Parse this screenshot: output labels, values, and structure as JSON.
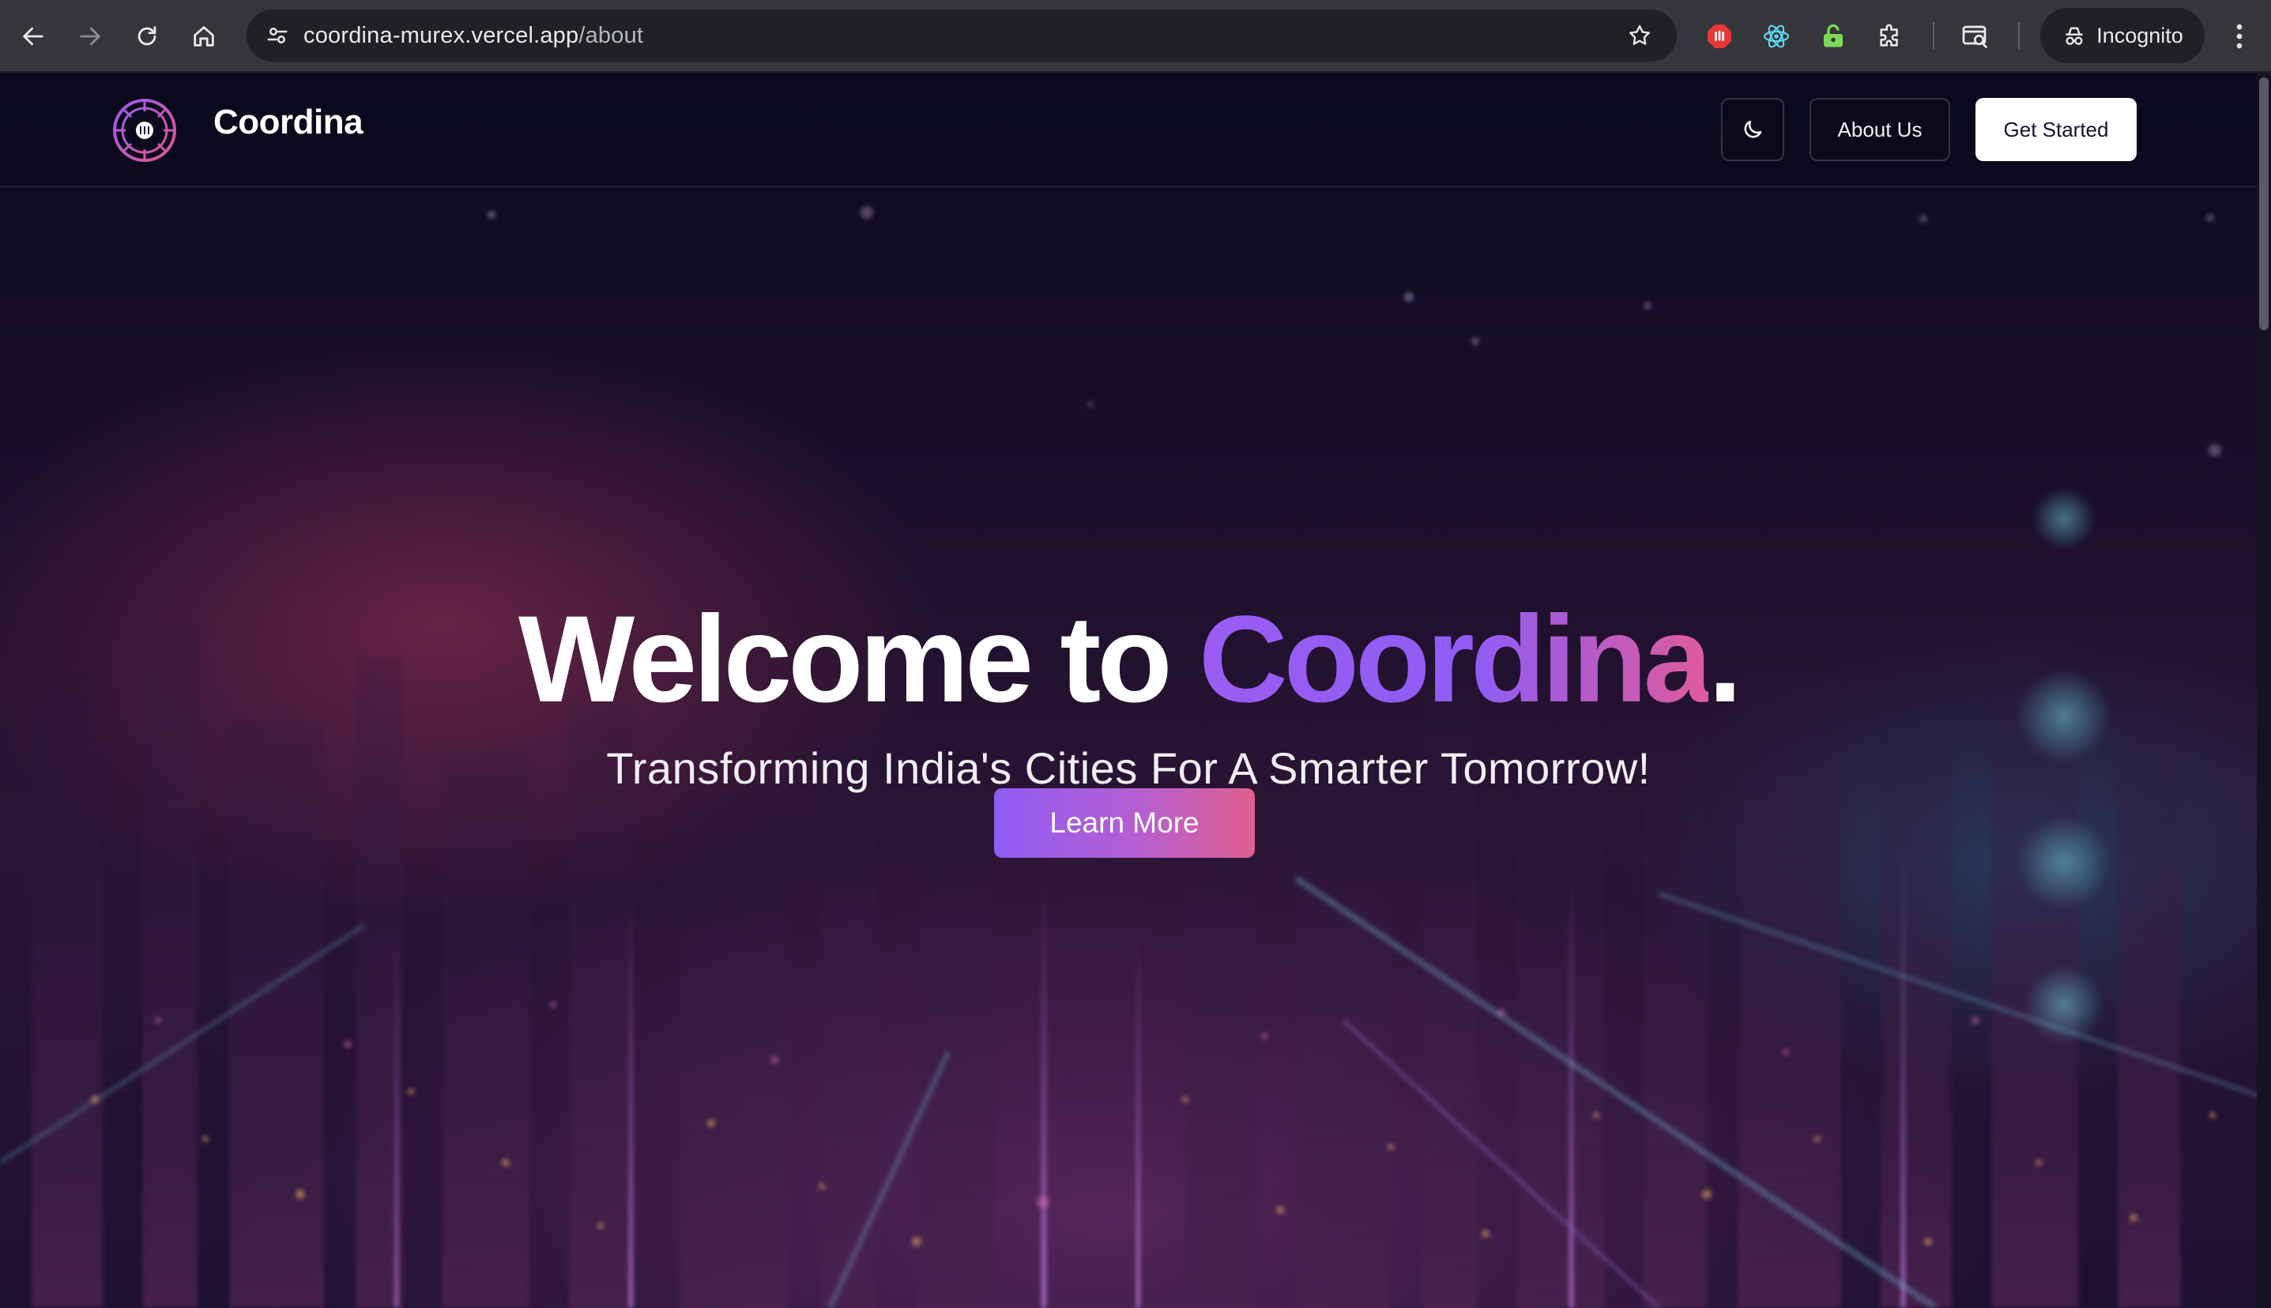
{
  "browser": {
    "url_host": "coordina-murex.vercel.app",
    "url_path": "/about",
    "profile_label": "Incognito",
    "icons": [
      "back-icon",
      "forward-icon",
      "reload-icon",
      "home-icon",
      "site-info-icon",
      "bookmark-star-icon",
      "adblock-extension-icon",
      "react-devtools-icon",
      "lock-extension-icon",
      "extensions-puzzle-icon",
      "tab-search-icon",
      "incognito-icon",
      "more-menu-icon"
    ]
  },
  "site": {
    "brand": "Coordina",
    "nav": {
      "about_label": "About Us",
      "cta_label": "Get Started"
    }
  },
  "hero": {
    "title_prefix": "Welcome to ",
    "title_accent": "Coordina",
    "title_suffix": ".",
    "subtitle": "Transforming India's Cities For A Smarter Tomorrow!",
    "button_label": "Learn More"
  },
  "colors": {
    "accent_purple": "#8f5cf3",
    "accent_pink": "#e05a9a",
    "page_bg": "#0c0b1f"
  }
}
